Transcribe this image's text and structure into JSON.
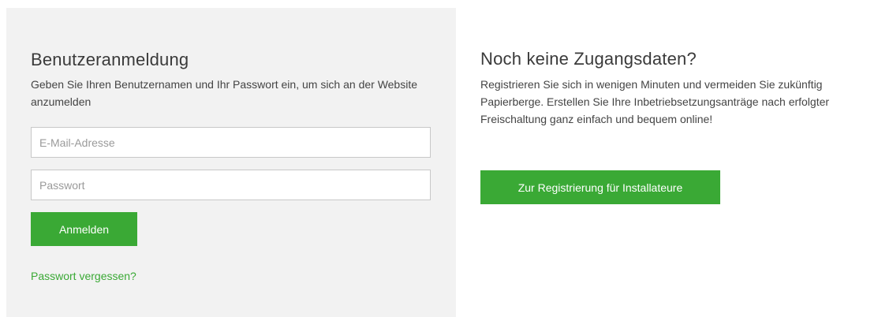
{
  "login": {
    "title": "Benutzeranmeldung",
    "description": "Geben Sie Ihren Benutzernamen und Ihr Passwort ein, um sich an der Website anzumelden",
    "email": {
      "placeholder": "E-Mail-Adresse",
      "value": ""
    },
    "password": {
      "placeholder": "Passwort",
      "value": ""
    },
    "submit_label": "Anmelden",
    "forgot_label": "Passwort vergessen?"
  },
  "register": {
    "title": "Noch keine Zugangsdaten?",
    "description": "Registrieren Sie sich in wenigen Minuten und vermeiden Sie zukünftig Papierberge. Erstellen Sie Ihre Inbetriebsetzungsanträge nach erfolgter Freischaltung ganz einfach und bequem online!",
    "button_label": "Zur Registrierung für Installateure"
  },
  "colors": {
    "accent": "#3aa935",
    "panel_background": "#f2f2f2"
  }
}
